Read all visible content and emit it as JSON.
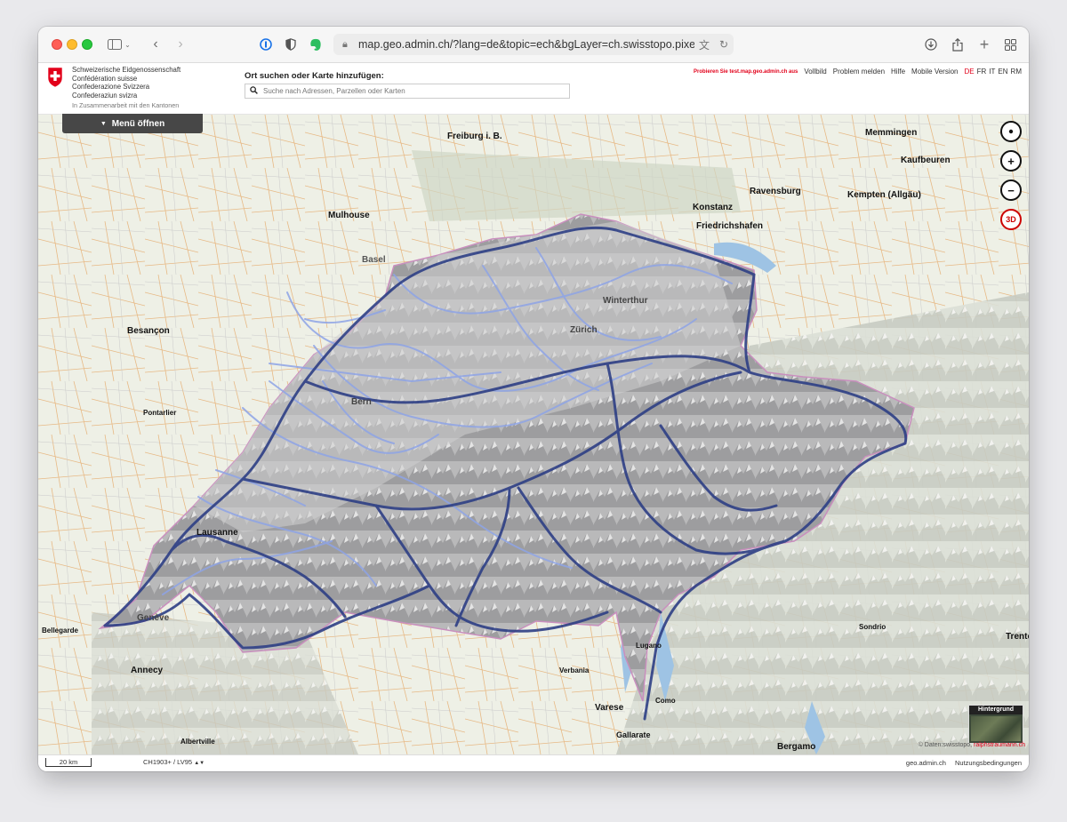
{
  "browser": {
    "url": "map.geo.admin.ch/?lang=de&topic=ech&bgLayer=ch.swisstopo.pixelkarte-farbe"
  },
  "header": {
    "confederation": [
      "Schweizerische Eidgenossenschaft",
      "Confédération suisse",
      "Confederazione Svizzera",
      "Confederaziun svizra"
    ],
    "subtitle": "In Zusammenarbeit mit den Kantonen",
    "search_label": "Ort suchen oder Karte hinzufügen:",
    "search_placeholder": "Suche nach Adressen, Parzellen oder Karten",
    "promo": "Probieren Sie test.map.geo.admin.ch aus",
    "links": [
      "Vollbild",
      "Problem melden",
      "Hilfe",
      "Mobile Version"
    ],
    "languages": [
      "DE",
      "FR",
      "IT",
      "EN",
      "RM"
    ],
    "active_language": "DE",
    "menu_label": "Menü öffnen"
  },
  "map": {
    "controls": {
      "three_d": "3D"
    },
    "background_label": "Hintergrund",
    "copyright_prefix": "© Daten:swisstopo, ",
    "copyright_link": "ralphstraumann.ch",
    "places": [
      {
        "name": "Freiburg i. B."
      },
      {
        "name": "Mulhouse"
      },
      {
        "name": "Basel"
      },
      {
        "name": "Besançon"
      },
      {
        "name": "Zürich"
      },
      {
        "name": "Winterthur"
      },
      {
        "name": "Konstanz"
      },
      {
        "name": "Friedrichshafen"
      },
      {
        "name": "Memmingen"
      },
      {
        "name": "Kaufbeuren"
      },
      {
        "name": "Kempten (Allgäu)"
      },
      {
        "name": "Ravensburg"
      },
      {
        "name": "Bern"
      },
      {
        "name": "Lausanne"
      },
      {
        "name": "Genève"
      },
      {
        "name": "Annecy"
      },
      {
        "name": "Varese"
      },
      {
        "name": "Como"
      },
      {
        "name": "Bergamo"
      },
      {
        "name": "Sondrio"
      },
      {
        "name": "Trento"
      },
      {
        "name": "Gallarate"
      },
      {
        "name": "Verbania"
      },
      {
        "name": "Lugano"
      },
      {
        "name": "Bellegarde"
      },
      {
        "name": "Albertville"
      },
      {
        "name": "Pontarlier"
      }
    ]
  },
  "footer": {
    "scale": "20 km",
    "crs": "CH1903+ / LV95",
    "links": [
      "geo.admin.ch",
      "Nutzungsbedingungen"
    ]
  }
}
